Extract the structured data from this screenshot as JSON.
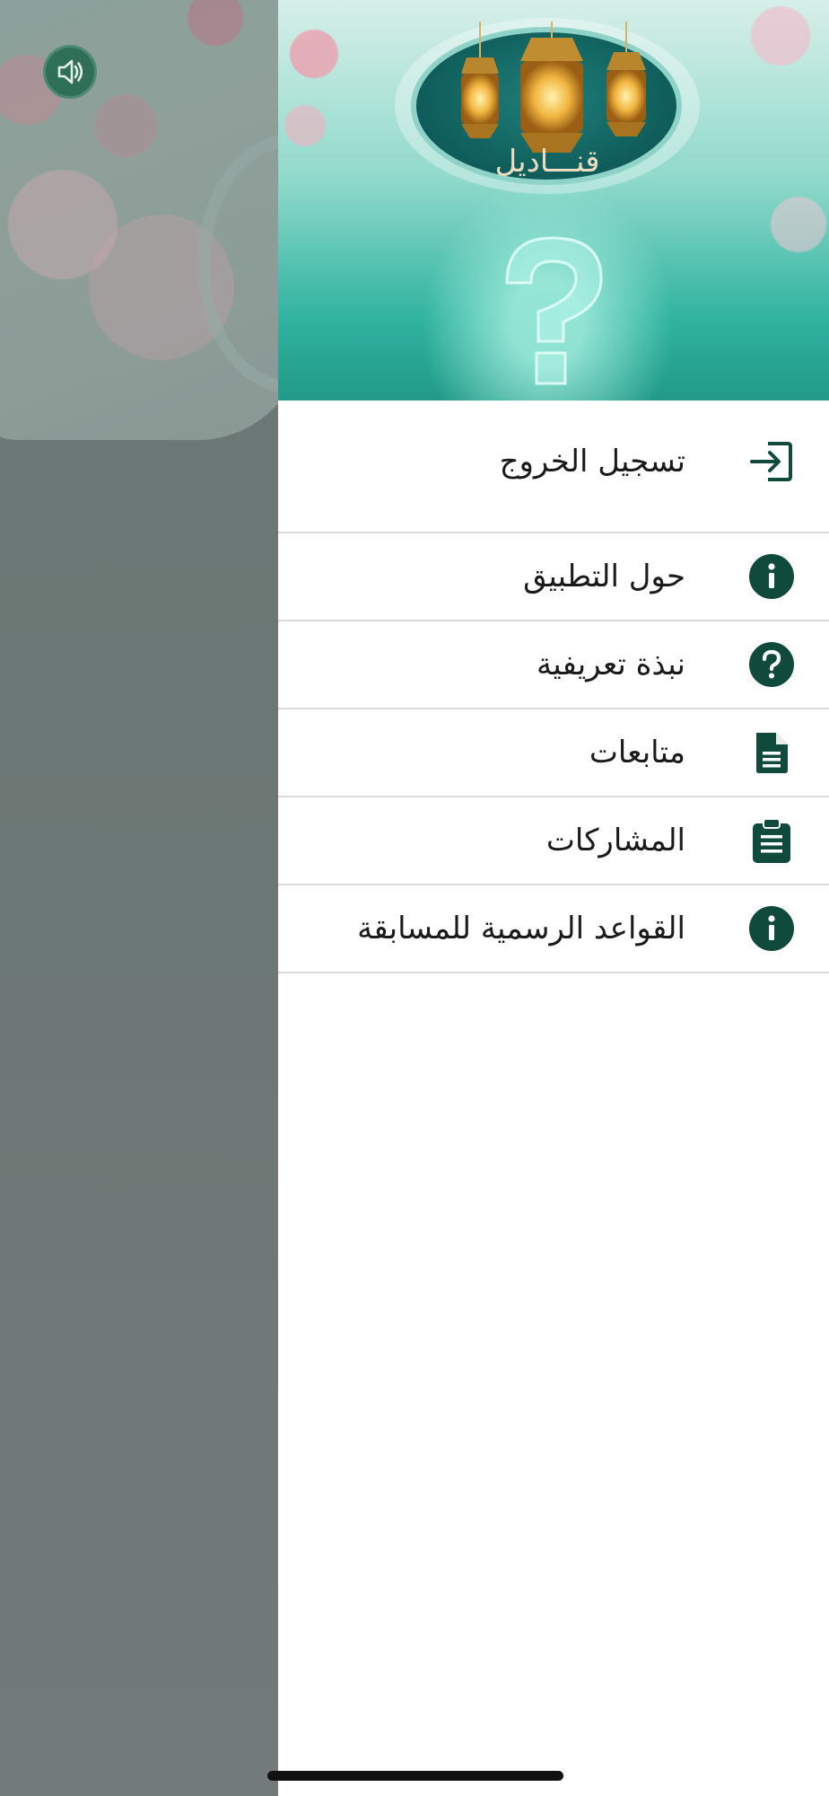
{
  "colors": {
    "icon": "#0f4a3c",
    "backdrop": "#6c7a77",
    "divider": "#d9d9d9",
    "text": "#1a1a1a"
  },
  "header": {
    "logo_title": "قنـــاديل"
  },
  "sound_button": {
    "icon": "speaker-icon"
  },
  "menu": {
    "logout": {
      "label": "تسجيل الخروج",
      "icon": "logout-icon"
    },
    "items": [
      {
        "label": "حول التطبيق",
        "icon": "info-icon"
      },
      {
        "label": "نبذة تعريفية",
        "icon": "help-icon"
      },
      {
        "label": "متابعات",
        "icon": "document-icon"
      },
      {
        "label": "المشاركات",
        "icon": "clipboard-icon"
      },
      {
        "label": "القواعد الرسمية للمسابقة",
        "icon": "info-icon"
      }
    ]
  }
}
